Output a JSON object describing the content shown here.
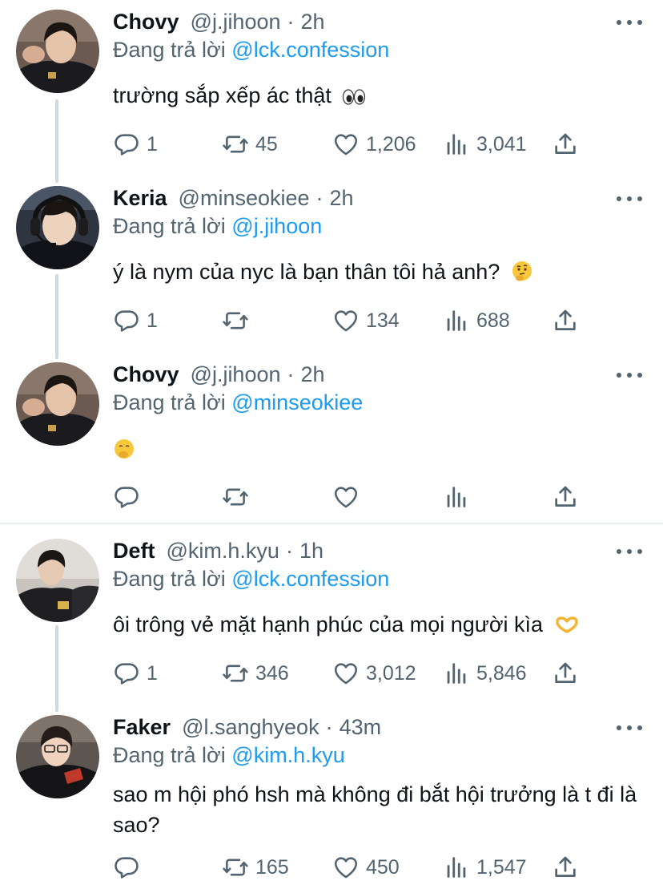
{
  "reply_prefix": "Đang trả lời",
  "tweets": [
    {
      "name": "Chovy",
      "handle": "@j.jihoon",
      "time": "2h",
      "reply_to": "@lck.confession",
      "text": "trường sắp xếp ác thật",
      "emoji": "eyes",
      "replies": "1",
      "retweets": "45",
      "likes": "1,206",
      "views": "3,041"
    },
    {
      "name": "Keria",
      "handle": "@minseokiee",
      "time": "2h",
      "reply_to": "@j.jihoon",
      "text": "ý là nym của nyc là bạn thân tôi hả anh?",
      "emoji": "thinking-face",
      "replies": "1",
      "retweets": "",
      "likes": "134",
      "views": "688"
    },
    {
      "name": "Chovy",
      "handle": "@j.jihoon",
      "time": "2h",
      "reply_to": "@minseokiee",
      "text": "",
      "emoji": "hand-over-mouth-face",
      "replies": "",
      "retweets": "",
      "likes": "",
      "views": ""
    },
    {
      "name": "Deft",
      "handle": "@kim.h.kyu",
      "time": "1h",
      "reply_to": "@lck.confession",
      "text": "ôi trông vẻ mặt hạnh phúc của mọi người kìa",
      "emoji": "heart-hands",
      "replies": "1",
      "retweets": "346",
      "likes": "3,012",
      "views": "5,846"
    },
    {
      "name": "Faker",
      "handle": "@l.sanghyeok",
      "time": "43m",
      "reply_to": "@kim.h.kyu",
      "text": "sao m hội phó hsh mà không đi bắt hội trưởng là t đi là sao?",
      "emoji": "",
      "replies": "",
      "retweets": "165",
      "likes": "450",
      "views": "1,547"
    }
  ],
  "colors": {
    "text": "#0f1419",
    "secondary": "#536471",
    "mention": "#1d9bf0",
    "thread_line": "#cfd9de",
    "divider": "#e7ecf0"
  },
  "icons": [
    "reply-icon",
    "retweet-icon",
    "like-icon",
    "views-icon",
    "share-icon",
    "more-icon"
  ]
}
